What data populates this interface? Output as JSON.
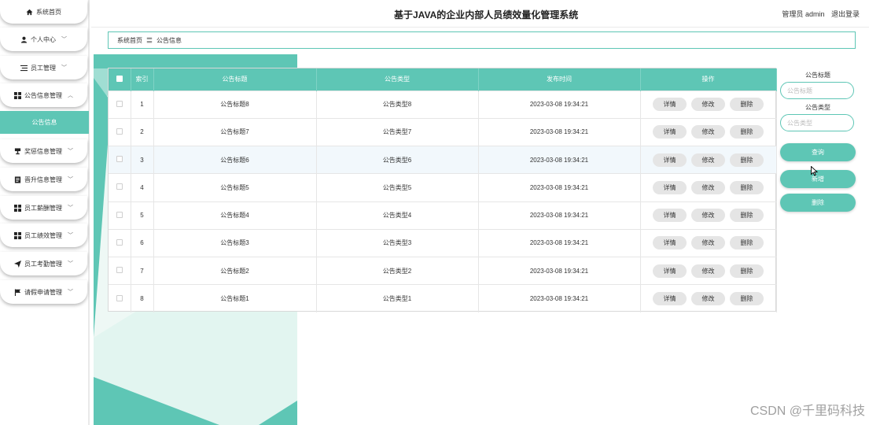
{
  "header": {
    "title": "基于JAVA的企业内部人员绩效量化管理系统",
    "user_role": "管理员",
    "username": "admin",
    "logout": "退出登录"
  },
  "sidebar": {
    "items": [
      {
        "label": "系统首页",
        "icon": "home-icon",
        "chevron": false
      },
      {
        "label": "个人中心",
        "icon": "user-icon",
        "chevron": true
      },
      {
        "label": "员工管理",
        "icon": "menu-lines-icon",
        "chevron": true
      },
      {
        "label": "公告信息管理",
        "icon": "grid-icon",
        "chevron": true,
        "expanded": true
      },
      {
        "label": "奖惩信息管理",
        "icon": "trophy-icon",
        "chevron": true
      },
      {
        "label": "晋升信息管理",
        "icon": "document-icon",
        "chevron": true
      },
      {
        "label": "员工薪酬管理",
        "icon": "grid-icon",
        "chevron": true
      },
      {
        "label": "员工绩效管理",
        "icon": "grid-icon",
        "chevron": true
      },
      {
        "label": "员工考勤管理",
        "icon": "send-icon",
        "chevron": true
      },
      {
        "label": "请假申请管理",
        "icon": "flag-icon",
        "chevron": true
      }
    ],
    "sub_active": "公告信息"
  },
  "breadcrumb": {
    "home": "系统首页",
    "separator": "〓",
    "current": "公告信息"
  },
  "table": {
    "headers": [
      "索引",
      "公告标题",
      "公告类型",
      "发布时间",
      "操作"
    ],
    "rows": [
      {
        "index": "1",
        "title": "公告标题8",
        "type": "公告类型8",
        "time": "2023-03-08 19:34:21"
      },
      {
        "index": "2",
        "title": "公告标题7",
        "type": "公告类型7",
        "time": "2023-03-08 19:34:21"
      },
      {
        "index": "3",
        "title": "公告标题6",
        "type": "公告类型6",
        "time": "2023-03-08 19:34:21"
      },
      {
        "index": "4",
        "title": "公告标题5",
        "type": "公告类型5",
        "time": "2023-03-08 19:34:21"
      },
      {
        "index": "5",
        "title": "公告标题4",
        "type": "公告类型4",
        "time": "2023-03-08 19:34:21"
      },
      {
        "index": "6",
        "title": "公告标题3",
        "type": "公告类型3",
        "time": "2023-03-08 19:34:21"
      },
      {
        "index": "7",
        "title": "公告标题2",
        "type": "公告类型2",
        "time": "2023-03-08 19:34:21"
      },
      {
        "index": "8",
        "title": "公告标题1",
        "type": "公告类型1",
        "time": "2023-03-08 19:34:21"
      }
    ],
    "actions": {
      "detail": "详情",
      "edit": "修改",
      "delete": "删除"
    }
  },
  "search": {
    "title_label": "公告标题",
    "title_placeholder": "公告标题",
    "type_label": "公告类型",
    "type_placeholder": "公告类型",
    "query_button": "查询",
    "add_button": "新增",
    "delete_button": "删除"
  },
  "watermark": "CSDN @千里码科技",
  "colors": {
    "accent": "#5ec6b5",
    "button_gray": "#e5e5e5"
  }
}
